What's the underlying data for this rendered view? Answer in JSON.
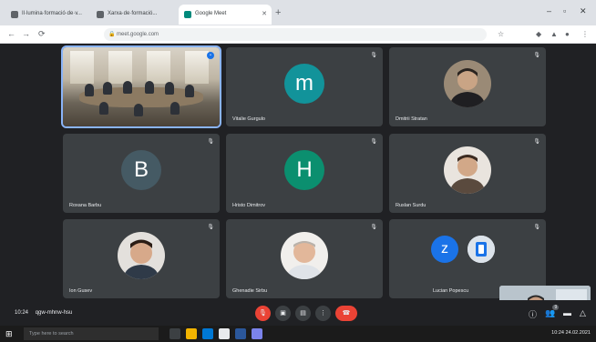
{
  "browser": {
    "tabs": [
      {
        "title": "Il·lumina·formació·de·v..."
      },
      {
        "title": "Xarxa·de·formació..."
      },
      {
        "title": "Google Meet"
      }
    ],
    "new_tab_icon": "plus-icon",
    "address": "meet.google.com"
  },
  "meet": {
    "accent": "#8ab4f8",
    "tiles": [
      {
        "name": "",
        "kind": "video-room"
      },
      {
        "name": "Vitalie Gurgulo",
        "kind": "letter",
        "letter": "m",
        "color": "#12939a"
      },
      {
        "name": "Dmitrii Stratan",
        "kind": "photo"
      },
      {
        "name": "Roxana Barbu",
        "kind": "letter",
        "letter": "B",
        "color": "#455a64"
      },
      {
        "name": "Hristo Dimitrov",
        "kind": "letter",
        "letter": "H",
        "color": "#0b8f6f"
      },
      {
        "name": "Ruslan Surdu",
        "kind": "photo"
      },
      {
        "name": "Ion Gusev",
        "kind": "photo"
      },
      {
        "name": "Ghenadie Sirbu",
        "kind": "photo"
      },
      {
        "name": "Lucian Popescu",
        "kind": "letter",
        "letter": "z",
        "color": "#1a73e8"
      }
    ],
    "self_view_label": "",
    "control_bar": {
      "time": "10:24",
      "meeting_code": "qgw-mhnw-hsu",
      "more_icon": "more-vert-icon",
      "participants_count": "9"
    }
  },
  "taskbar": {
    "search_placeholder": "Type here to search",
    "time": "10:24",
    "date": "24.02.2021"
  }
}
